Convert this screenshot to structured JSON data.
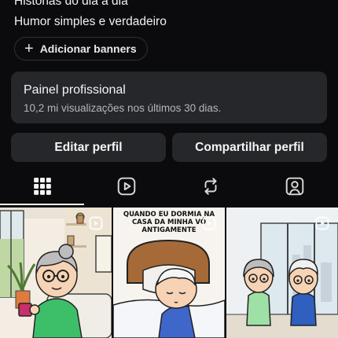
{
  "profile": {
    "bio_line1": "Histórias do dia a dia",
    "bio_line2": "Humor simples e verdadeiro",
    "add_banners_label": "Adicionar banners"
  },
  "panel": {
    "title": "Painel profissional",
    "subtitle": "10,2 mi visualizações nos últimos 30 dias."
  },
  "actions": {
    "edit_label": "Editar perfil",
    "share_label": "Compartilhar perfil"
  },
  "tabs": [
    {
      "icon": "grid-icon",
      "active": true
    },
    {
      "icon": "reels-icon",
      "active": false
    },
    {
      "icon": "repost-icon",
      "active": false
    },
    {
      "icon": "tagged-icon",
      "active": false
    }
  ],
  "posts": [
    {
      "type": "reel",
      "caption": ""
    },
    {
      "type": "reel",
      "caption": "QUANDO EU DORMIA NA CASA DA MINHA VÓ ANTIGAMENTE"
    },
    {
      "type": "reel",
      "caption": ""
    }
  ],
  "colors": {
    "background": "#0b0b0d",
    "card": "#25272b",
    "text": "#f5f5f5",
    "muted": "#b4b6bb"
  }
}
